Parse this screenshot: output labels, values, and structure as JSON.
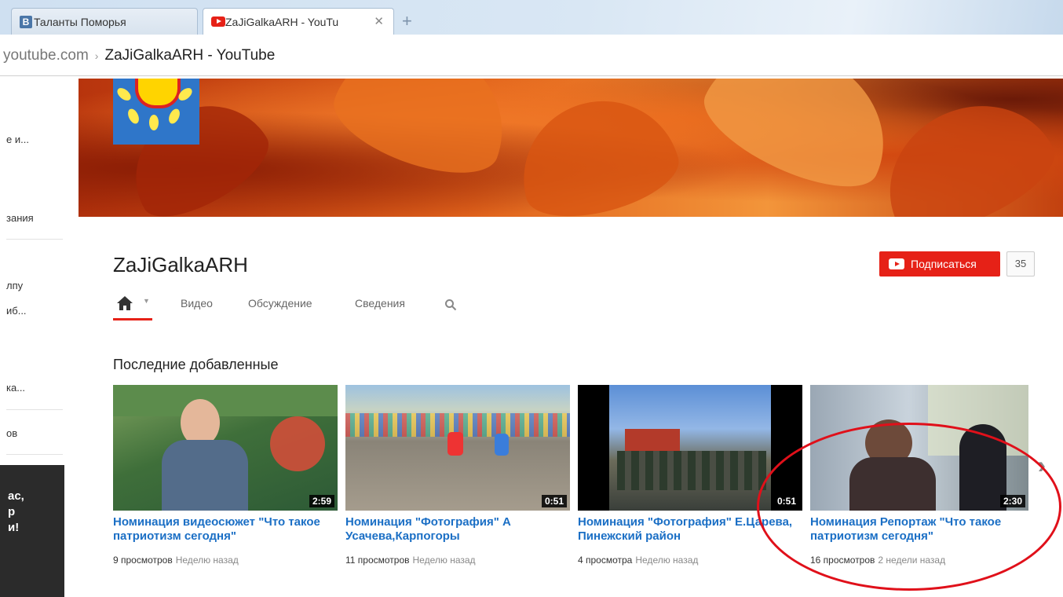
{
  "browser": {
    "tabs": [
      {
        "label": "Таланты Поморья",
        "icon": "vk-icon"
      },
      {
        "label": "ZaJiGalkaARH - YouTu",
        "icon": "youtube-icon"
      }
    ],
    "new_tab": "+",
    "address": {
      "domain": "youtube.com",
      "separator": "›",
      "page": "ZaJiGalkaARH - YouTube"
    }
  },
  "sidebar": {
    "items": [
      "е и...",
      "зания",
      "лпу",
      "иб...",
      "ка...",
      "ов"
    ],
    "promo_text": "ас,\nр\nи!"
  },
  "channel": {
    "name": "ZaJiGalkaARH",
    "subscribe_label": "Подписаться",
    "subscriber_count": "35",
    "nav": [
      "Видео",
      "Обсуждение",
      "Сведения"
    ]
  },
  "section": {
    "title": "Последние добавленные",
    "videos": [
      {
        "title": "Номинация видеосюжет \"Что такое патриотизм сегодня\"",
        "duration": "2:59",
        "views": "9 просмотров",
        "ago": "Неделю назад"
      },
      {
        "title": "Номинация \"Фотография\" А Усачева,Карпогоры",
        "duration": "0:51",
        "views": "11 просмотров",
        "ago": "Неделю назад"
      },
      {
        "title": "Номинация \"Фотография\" Е.Царева, Пинежский район",
        "duration": "0:51",
        "views": "4 просмотра",
        "ago": "Неделю назад"
      },
      {
        "title": "Номинация Репортаж \"Что такое патриотизм сегодня\"",
        "duration": "2:30",
        "views": "16 просмотров",
        "ago": "2 недели назад"
      }
    ]
  },
  "colors": {
    "accent": "#e62117",
    "link": "#1b6fc5"
  }
}
